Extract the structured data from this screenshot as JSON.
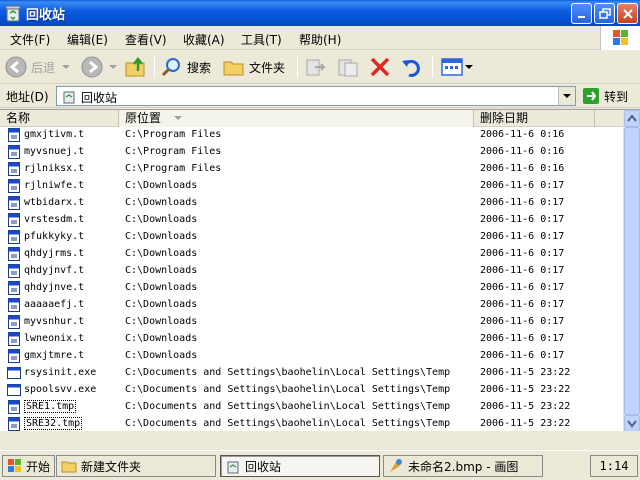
{
  "window": {
    "title": "回收站"
  },
  "menu": {
    "items": [
      "文件(F)",
      "编辑(E)",
      "查看(V)",
      "收藏(A)",
      "工具(T)",
      "帮助(H)"
    ]
  },
  "toolbar": {
    "back": "后退",
    "search": "搜索",
    "folders": "文件夹"
  },
  "address": {
    "label": "地址(D)",
    "value": "回收站",
    "go": "转到"
  },
  "columns": [
    "名称",
    "原位置",
    "删除日期"
  ],
  "files": [
    {
      "name": "gmxjtivm.t",
      "location": "C:\\Program Files",
      "date": "2006-11-6 0:16"
    },
    {
      "name": "myvsnuej.t",
      "location": "C:\\Program Files",
      "date": "2006-11-6 0:16"
    },
    {
      "name": "rjlniksx.t",
      "location": "C:\\Program Files",
      "date": "2006-11-6 0:16"
    },
    {
      "name": "rjlniwfe.t",
      "location": "C:\\Downloads",
      "date": "2006-11-6 0:17"
    },
    {
      "name": "wtbidarx.t",
      "location": "C:\\Downloads",
      "date": "2006-11-6 0:17"
    },
    {
      "name": "vrstesdm.t",
      "location": "C:\\Downloads",
      "date": "2006-11-6 0:17"
    },
    {
      "name": "pfukkyky.t",
      "location": "C:\\Downloads",
      "date": "2006-11-6 0:17"
    },
    {
      "name": "qhdyjrms.t",
      "location": "C:\\Downloads",
      "date": "2006-11-6 0:17"
    },
    {
      "name": "qhdyjnvf.t",
      "location": "C:\\Downloads",
      "date": "2006-11-6 0:17"
    },
    {
      "name": "qhdyjnve.t",
      "location": "C:\\Downloads",
      "date": "2006-11-6 0:17"
    },
    {
      "name": "aaaaaefj.t",
      "location": "C:\\Downloads",
      "date": "2006-11-6 0:17"
    },
    {
      "name": "myvsnhur.t",
      "location": "C:\\Downloads",
      "date": "2006-11-6 0:17"
    },
    {
      "name": "lwneonix.t",
      "location": "C:\\Downloads",
      "date": "2006-11-6 0:17"
    },
    {
      "name": "gmxjtmre.t",
      "location": "C:\\Downloads",
      "date": "2006-11-6 0:17"
    },
    {
      "name": "rsysinit.exe",
      "location": "C:\\Documents and Settings\\baohelin\\Local Settings\\Temp",
      "date": "2006-11-5 23:22"
    },
    {
      "name": "spoolsvv.exe",
      "location": "C:\\Documents and Settings\\baohelin\\Local Settings\\Temp",
      "date": "2006-11-5 23:22"
    },
    {
      "name": "SRE1.tmp",
      "location": "C:\\Documents and Settings\\baohelin\\Local Settings\\Temp",
      "date": "2006-11-5 23:22"
    },
    {
      "name": "SRE32.tmp",
      "location": "C:\\Documents and Settings\\baohelin\\Local Settings\\Temp",
      "date": "2006-11-5 23:22"
    }
  ],
  "taskbar": {
    "start": "开始",
    "tasks": [
      "新建文件夹",
      "回收站",
      "未命名2.bmp - 画图"
    ],
    "clock": "1:14"
  },
  "icons": {
    "app": "recycle-bin-icon",
    "file": "file-icon",
    "exe": "application-icon"
  }
}
